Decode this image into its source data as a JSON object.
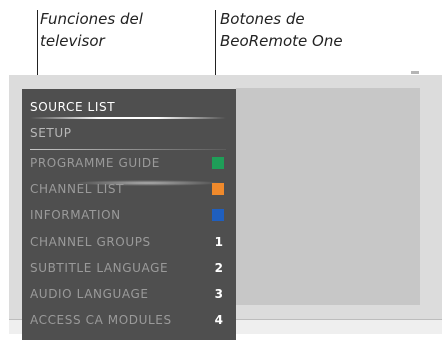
{
  "captions": {
    "left": {
      "line1": "Funciones del",
      "line2": "televisor"
    },
    "right": {
      "line1": "Botones de",
      "line2": "BeoRemote One"
    }
  },
  "menu": {
    "items": [
      {
        "label": "SOURCE LIST"
      },
      {
        "label": "SETUP"
      },
      {
        "label": "PROGRAMME GUIDE",
        "button": "green-button",
        "color": "#1f9e58"
      },
      {
        "label": "CHANNEL LIST",
        "button": "yellow-button",
        "color": "#f08a2c"
      },
      {
        "label": "INFORMATION",
        "button": "blue-button",
        "color": "#1f5fbf"
      },
      {
        "label": "CHANNEL GROUPS",
        "number": "1"
      },
      {
        "label": "SUBTITLE LANGUAGE",
        "number": "2"
      },
      {
        "label": "AUDIO LANGUAGE",
        "number": "3"
      },
      {
        "label": "ACCESS CA MODULES",
        "number": "4"
      }
    ]
  }
}
